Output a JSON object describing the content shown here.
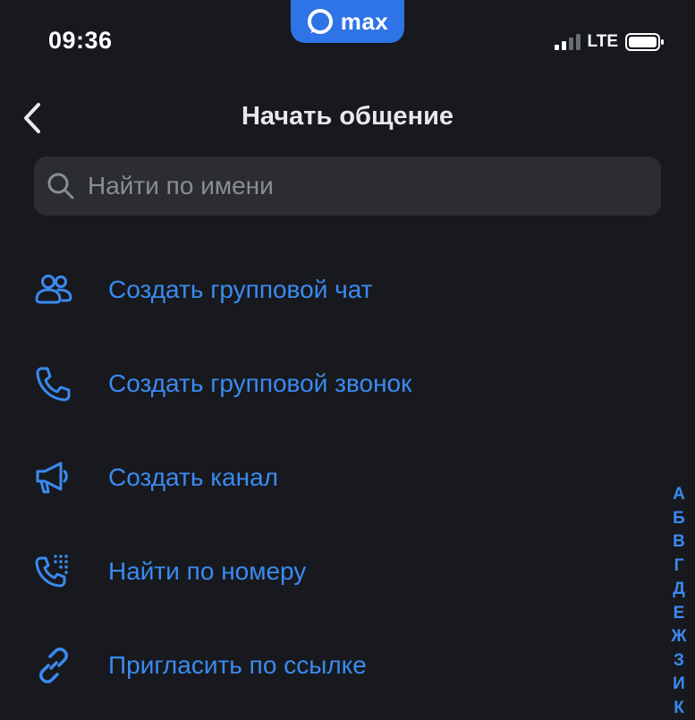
{
  "status_bar": {
    "time": "09:36",
    "network": "LTE",
    "brand_name": "max"
  },
  "header": {
    "title": "Начать общение"
  },
  "search": {
    "placeholder": "Найти по имени"
  },
  "colors": {
    "background": "#17191e",
    "accent": "#3b8af0",
    "brand": "#2e74e6",
    "search_bg": "#2b2d33"
  },
  "actions": [
    {
      "label": "Создать групповой чат",
      "icon": "group-icon"
    },
    {
      "label": "Создать групповой звонок",
      "icon": "phone-icon"
    },
    {
      "label": "Создать канал",
      "icon": "megaphone-icon"
    },
    {
      "label": "Найти по номеру",
      "icon": "phone-keypad-icon"
    },
    {
      "label": "Пригласить по ссылке",
      "icon": "link-icon"
    }
  ],
  "alphabet_index": [
    "А",
    "Б",
    "В",
    "Г",
    "Д",
    "Е",
    "Ж",
    "З",
    "И",
    "К"
  ]
}
